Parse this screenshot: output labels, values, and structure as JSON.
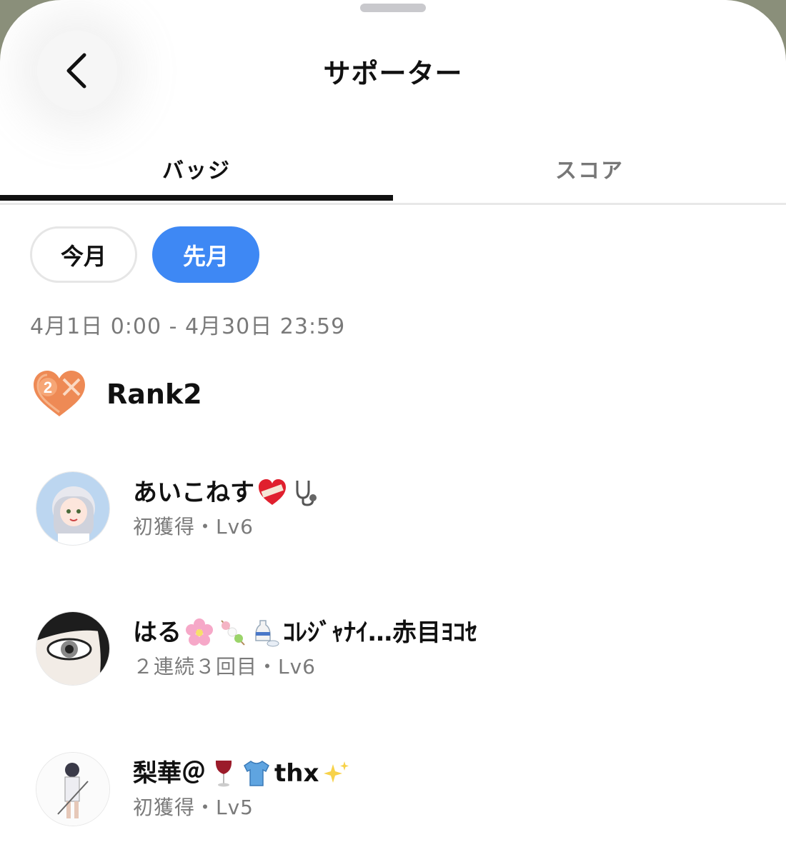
{
  "header": {
    "title": "サポーター"
  },
  "tabs": [
    {
      "label": "バッジ",
      "active": true
    },
    {
      "label": "スコア",
      "active": false
    }
  ],
  "period_filter": {
    "options": [
      "今月",
      "先月"
    ],
    "selected": "先月"
  },
  "period_range": "4月1日 0:00 - 4月30日 23:59",
  "rank": {
    "label": "Rank2",
    "badge_number": "2"
  },
  "supporters": [
    {
      "name": "あいこねす",
      "emojis": [
        "heart-bandage",
        "stethoscope"
      ],
      "status": "初獲得・Lv6"
    },
    {
      "name": "はる",
      "emojis": [
        "cherry-blossom",
        "dango",
        "sake"
      ],
      "name_suffix": "ｺﾚｼﾞｬﾅｲ…赤目ﾖｺｾ",
      "status": "２連続３回目・Lv6"
    },
    {
      "name": "梨華＠",
      "emojis": [
        "wine-glass",
        "shirt"
      ],
      "name_suffix": "thx",
      "trailing_emoji": "sparkles",
      "status": "初獲得・Lv5"
    }
  ],
  "colors": {
    "accent_blue": "#3e88f4",
    "rank_badge_orange": "#ee8a55",
    "text_secondary": "#7a7a7a"
  }
}
